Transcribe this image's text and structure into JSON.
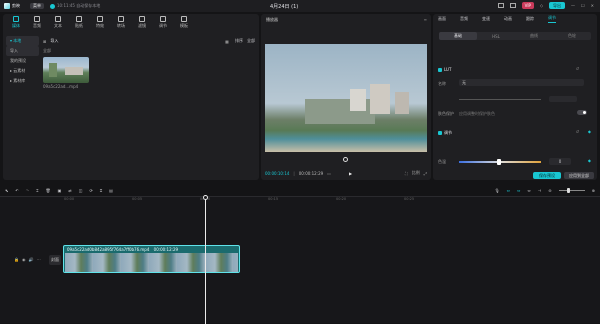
{
  "app": {
    "name": "剪映",
    "menu": "菜单",
    "save_status": "10:11:45 自动保存本地",
    "project_title": "4月24日 (1)",
    "vip": "VIP",
    "export": "导出"
  },
  "toolbar": [
    {
      "label": "媒体",
      "icon": "media-icon"
    },
    {
      "label": "音频",
      "icon": "audio-icon"
    },
    {
      "label": "文本",
      "icon": "text-icon"
    },
    {
      "label": "贴纸",
      "icon": "sticker-icon"
    },
    {
      "label": "特效",
      "icon": "effects-icon"
    },
    {
      "label": "转场",
      "icon": "transition-icon"
    },
    {
      "label": "滤镜",
      "icon": "filter-icon"
    },
    {
      "label": "调节",
      "icon": "adjust-icon"
    },
    {
      "label": "模板",
      "icon": "template-icon"
    }
  ],
  "sidebar": {
    "items": [
      {
        "label": "▾ 本地"
      },
      {
        "label": "导入"
      },
      {
        "label": "我的预设"
      },
      {
        "label": "▸ 云素材"
      },
      {
        "label": "▸ 素材库"
      }
    ]
  },
  "media": {
    "import_label": "导入",
    "sort_label": "排序",
    "filter_label": "全部",
    "section": "全部",
    "items": [
      {
        "name": "09a5c22ad...mp4"
      }
    ]
  },
  "player": {
    "title": "播放器",
    "current_time": "00:00:10:14",
    "total_time": "00:00:12:29",
    "ratio": "比例"
  },
  "props": {
    "tabs": [
      "画面",
      "音频",
      "变速",
      "动画",
      "跟踪",
      "调节"
    ],
    "subtabs": [
      "基础",
      "HSL",
      "曲线",
      "色轮"
    ],
    "lut_label": "LUT",
    "name_label": "名称",
    "name_value": "无",
    "skin_label": "肤色保护",
    "skin_desc": "应用调整时保护肤色",
    "adjust_label": "调节",
    "color_temp": "色温",
    "temp_value": "0",
    "save_preset": "保存预设",
    "apply_all": "应用到全部"
  },
  "timeline": {
    "ruler": [
      "00:00",
      "00:05",
      "00:10",
      "00:15",
      "00:20",
      "00:25"
    ],
    "track_label": "封面",
    "clip_name": "09a5c22ad0b842a895f764a7ff0b76.mp4",
    "clip_duration": "00:00:12:29"
  }
}
